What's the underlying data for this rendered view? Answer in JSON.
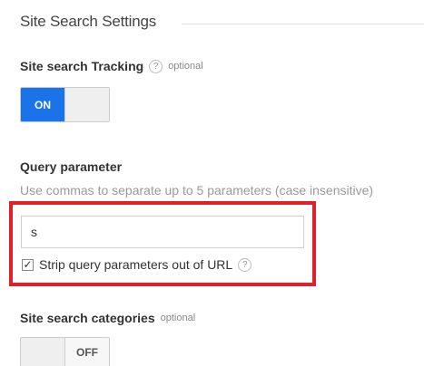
{
  "section": {
    "title": "Site Search Settings"
  },
  "tracking": {
    "label": "Site search Tracking",
    "help_glyph": "?",
    "optional": "optional",
    "toggle_label": "ON",
    "enabled": true
  },
  "query": {
    "label": "Query parameter",
    "help_text": "Use commas to separate up to 5 parameters (case insensitive)",
    "value": "s",
    "strip_label": "Strip query parameters out of URL",
    "strip_help_glyph": "?",
    "strip_checked": true,
    "check_glyph": "✓",
    "highlight_color": "#e0202a"
  },
  "categories": {
    "label": "Site search categories",
    "optional": "optional",
    "toggle_label": "OFF",
    "enabled": false
  },
  "colors": {
    "accent": "#1a73e8"
  }
}
